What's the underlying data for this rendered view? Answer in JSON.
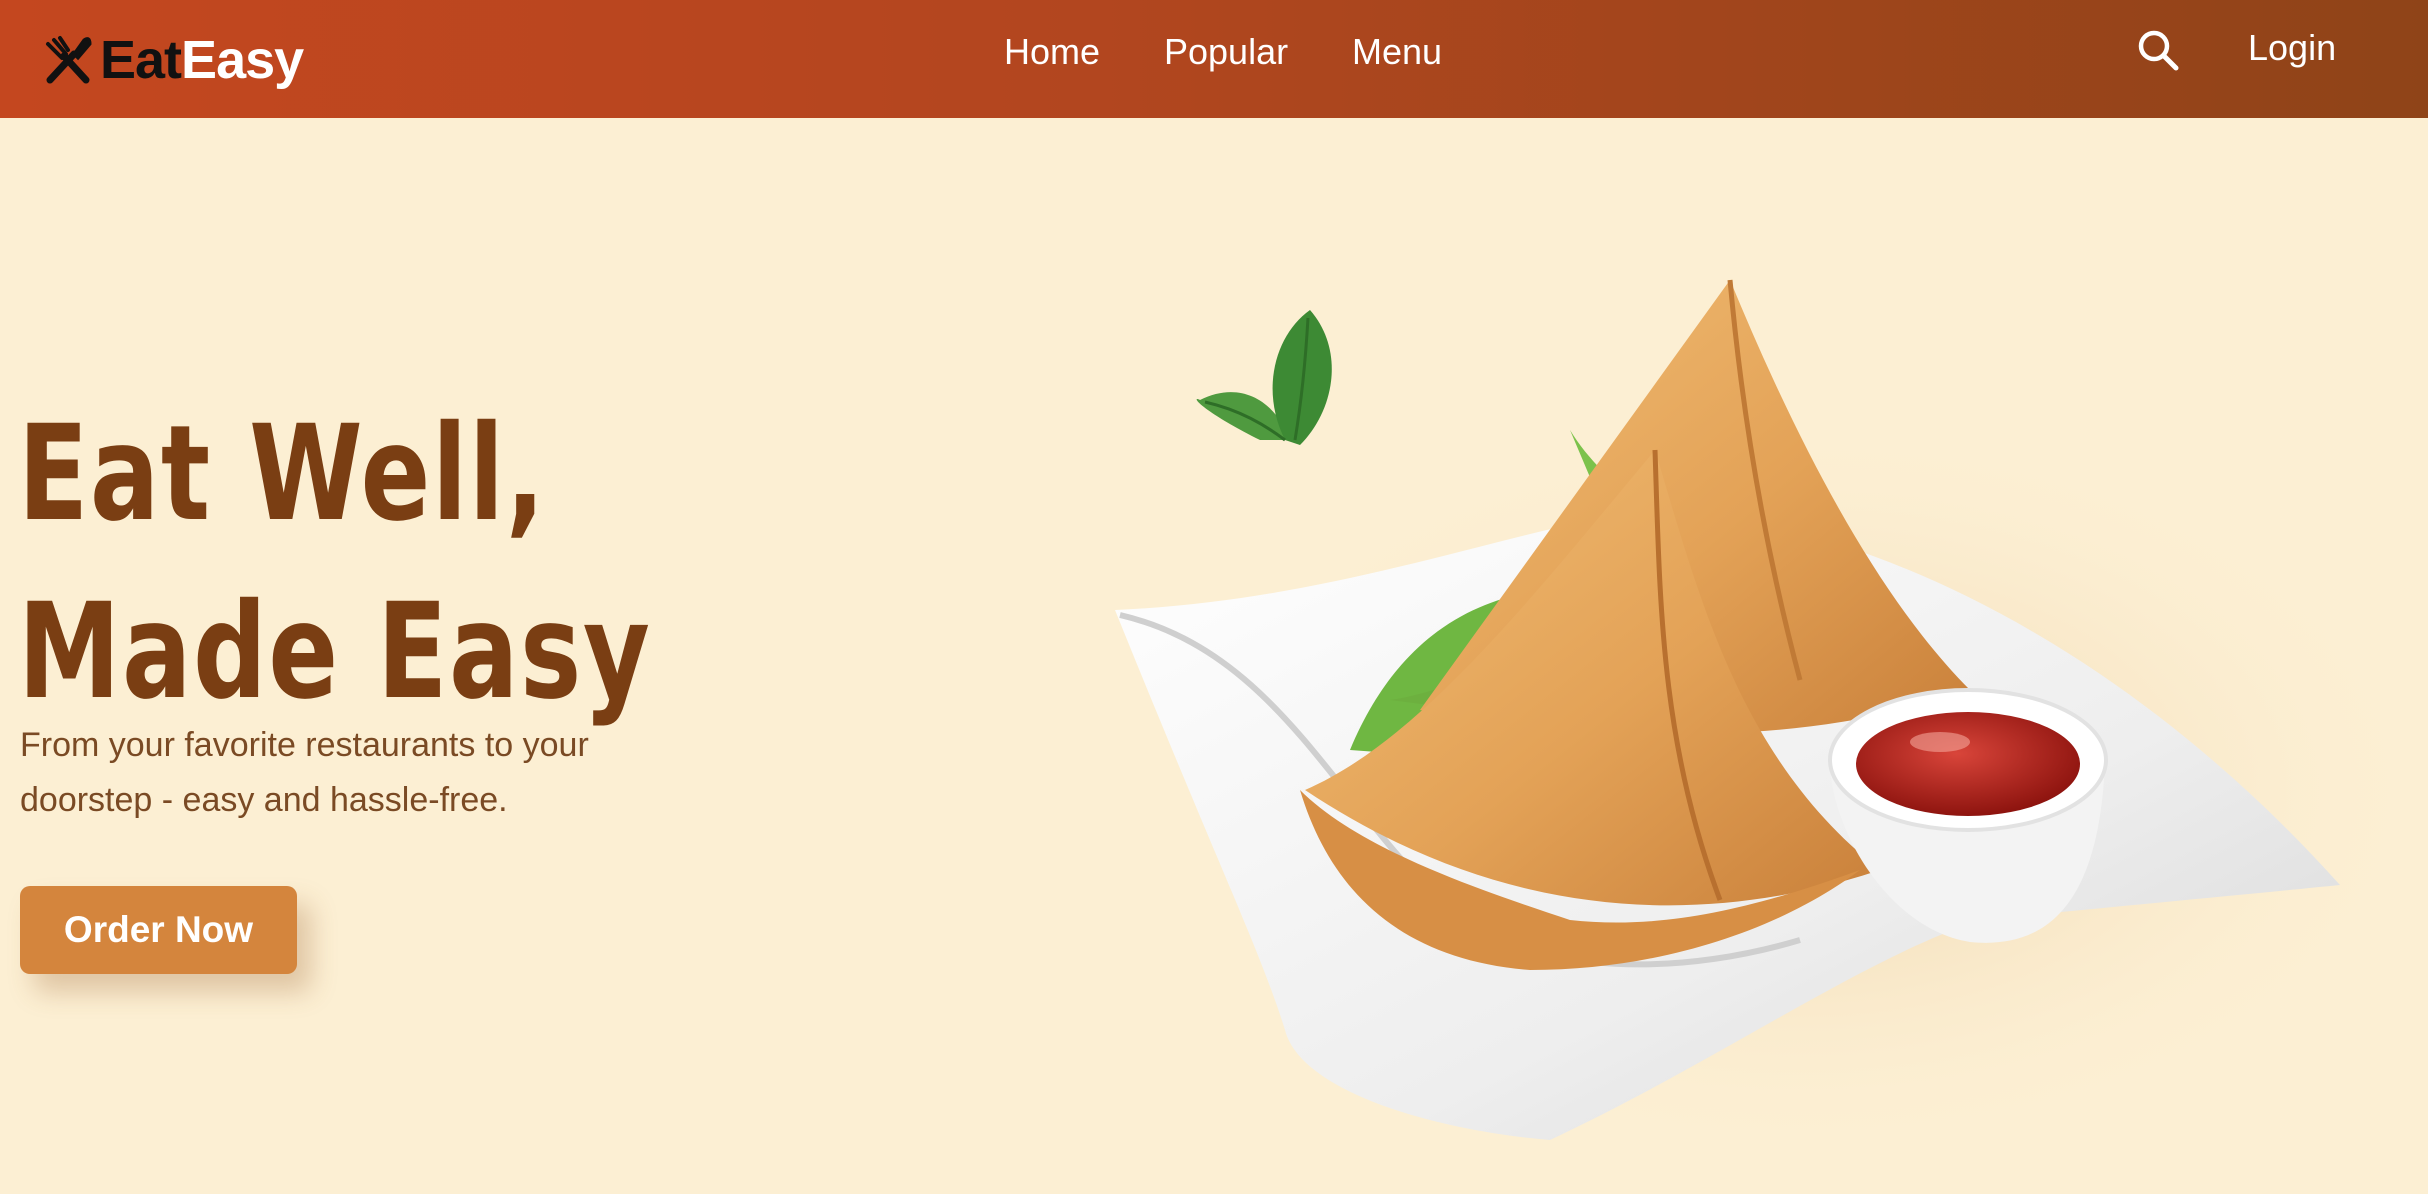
{
  "brand": {
    "part1": "Eat",
    "part2": "Easy",
    "icon": "fork-knife-icon"
  },
  "nav": {
    "items": [
      {
        "label": "Home"
      },
      {
        "label": "Popular"
      },
      {
        "label": "Menu"
      }
    ],
    "search_icon": "search-icon",
    "login_label": "Login"
  },
  "hero": {
    "title_line1": "Eat Well,",
    "title_line2": "Made Easy",
    "subtitle": "From your favorite restaurants to your doorstep - easy and hassle-free.",
    "cta_label": "Order Now",
    "image": "samosa-plate-with-mint-and-ketchup"
  },
  "colors": {
    "nav_gradient_start": "#c4471f",
    "nav_gradient_end": "#8f4418",
    "background": "#fcefd3",
    "title": "#7a3e13",
    "subtitle": "#7a4a24",
    "cta": "#d4853d"
  }
}
